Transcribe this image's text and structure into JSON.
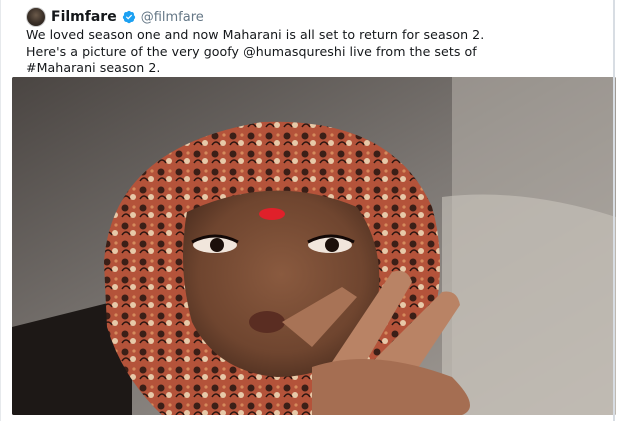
{
  "tweet": {
    "display_name": "Filmfare",
    "handle": "@filmfare",
    "text_lines": [
      "We loved season one and now Maharani is all set to return for season 2.",
      "Here's a picture of the very goofy @humasqureshi live from the sets of",
      "#Maharani season 2."
    ]
  },
  "icons": {
    "verified": "verified-badge-icon",
    "avatar": "filmfare-avatar"
  },
  "colors": {
    "text": "#14171a",
    "handle": "#657786",
    "verified": "#1da1f2"
  }
}
